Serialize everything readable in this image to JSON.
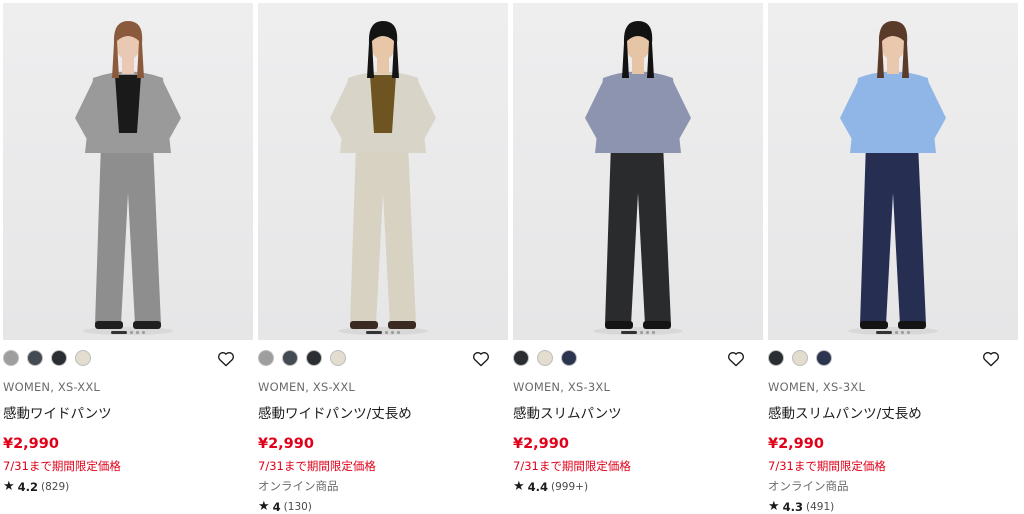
{
  "products": [
    {
      "swatches": [
        "#9e9e9e",
        "#444a52",
        "#2a2d32",
        "#e3ddd0"
      ],
      "meta": "WOMEN, XS-XXL",
      "name": "感動ワイドパンツ",
      "price": "¥2,990",
      "promo": "7/31まで期間限定価格",
      "online": "",
      "rating": "4.2",
      "count": "(829)",
      "outfit": {
        "jacket": "#9a9a9a",
        "top": "#1a1a1a",
        "pants": "#8e8e8e",
        "shoes": "#1f1f1f",
        "hair": "#8b5a3c",
        "skin": "#e9c9b3"
      }
    },
    {
      "swatches": [
        "#9e9e9e",
        "#444a52",
        "#2a2d32",
        "#e3ddd0"
      ],
      "meta": "WOMEN, XS-XXL",
      "name": "感動ワイドパンツ/丈長め",
      "price": "¥2,990",
      "promo": "7/31まで期間限定価格",
      "online": "オンライン商品",
      "rating": "4",
      "count": "(130)",
      "outfit": {
        "jacket": "#d9d4c8",
        "top": "#6e5420",
        "pants": "#d8d2c3",
        "shoes": "#3a2a22",
        "hair": "#141414",
        "skin": "#e8c7a9"
      }
    },
    {
      "swatches": [
        "#2a2d32",
        "#e3ddd0",
        "#2c3550"
      ],
      "meta": "WOMEN, XS-3XL",
      "name": "感動スリムパンツ",
      "price": "¥2,990",
      "promo": "7/31まで期間限定価格",
      "online": "",
      "rating": "4.4",
      "count": "(999+)",
      "outfit": {
        "jacket": "#8d94b0",
        "top": "#8d94b0",
        "pants": "#2a2b2d",
        "shoes": "#141414",
        "hair": "#121212",
        "skin": "#e6c4a6"
      }
    },
    {
      "swatches": [
        "#2a2d32",
        "#e3ddd0",
        "#2c3550"
      ],
      "meta": "WOMEN, XS-3XL",
      "name": "感動スリムパンツ/丈長め",
      "price": "¥2,990",
      "promo": "7/31まで期間限定価格",
      "online": "オンライン商品",
      "rating": "4.3",
      "count": "(491)",
      "outfit": {
        "jacket": "#8fb6e6",
        "top": "#8fb6e6",
        "pants": "#262f52",
        "shoes": "#141414",
        "hair": "#5a3a28",
        "skin": "#e9c8ae"
      }
    }
  ],
  "icons": {
    "favorite": "heart-outline-icon",
    "rating": "star-icon"
  },
  "colors": {
    "price": "#e0001a",
    "promo": "#e0001a",
    "text": "#1b1b1b",
    "muted": "#6b6b6b"
  }
}
